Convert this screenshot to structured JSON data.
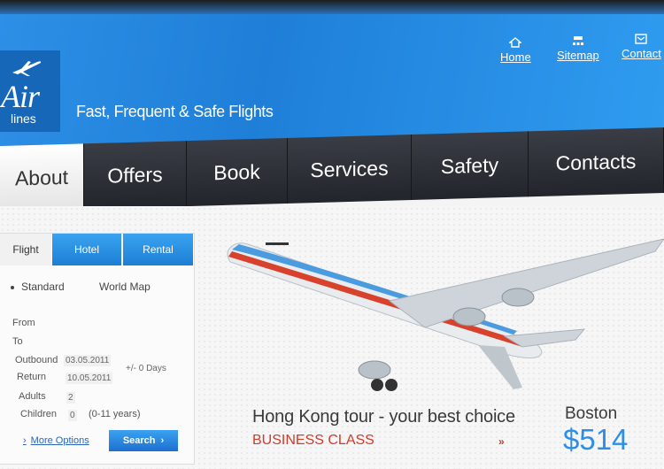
{
  "brand": {
    "logo_main": "Air",
    "logo_sub": "lines",
    "tagline": "Fast, Frequent & Safe Flights"
  },
  "top_links": [
    {
      "label": "Home",
      "icon": "home-icon"
    },
    {
      "label": "Sitemap",
      "icon": "sitemap-icon"
    },
    {
      "label": "Contact",
      "icon": "contact-icon"
    }
  ],
  "nav": {
    "items": [
      {
        "label": "About",
        "active": true
      },
      {
        "label": "Offers"
      },
      {
        "label": "Book"
      },
      {
        "label": "Services"
      },
      {
        "label": "Safety"
      },
      {
        "label": "Contacts"
      }
    ]
  },
  "booking": {
    "tabs": [
      "Flight",
      "Hotel",
      "Rental"
    ],
    "radio_options": [
      "Standard",
      "World Map"
    ],
    "fields": {
      "from_label": "From",
      "to_label": "To",
      "outbound_label": "Outbound",
      "outbound_value": "03.05.2011",
      "return_label": "Return",
      "return_value": "10.05.2011",
      "days_label": "+/- 0 Days",
      "adults_label": "Adults",
      "adults_value": "2",
      "children_label": "Children",
      "children_value": "0",
      "children_hint": "(0-11 years)"
    },
    "more_options": "More Options",
    "search_label": "Search"
  },
  "promo": {
    "title": "Hong Kong tour - your best choice",
    "class": "BUSINESS CLASS",
    "arrow": "»",
    "city": "Boston",
    "price": "$514"
  },
  "colors": {
    "header_blue": "#2d8fe6",
    "nav_dark": "#2b2e35",
    "promo_red": "#d23a2a",
    "price_blue": "#2d8fe6"
  }
}
